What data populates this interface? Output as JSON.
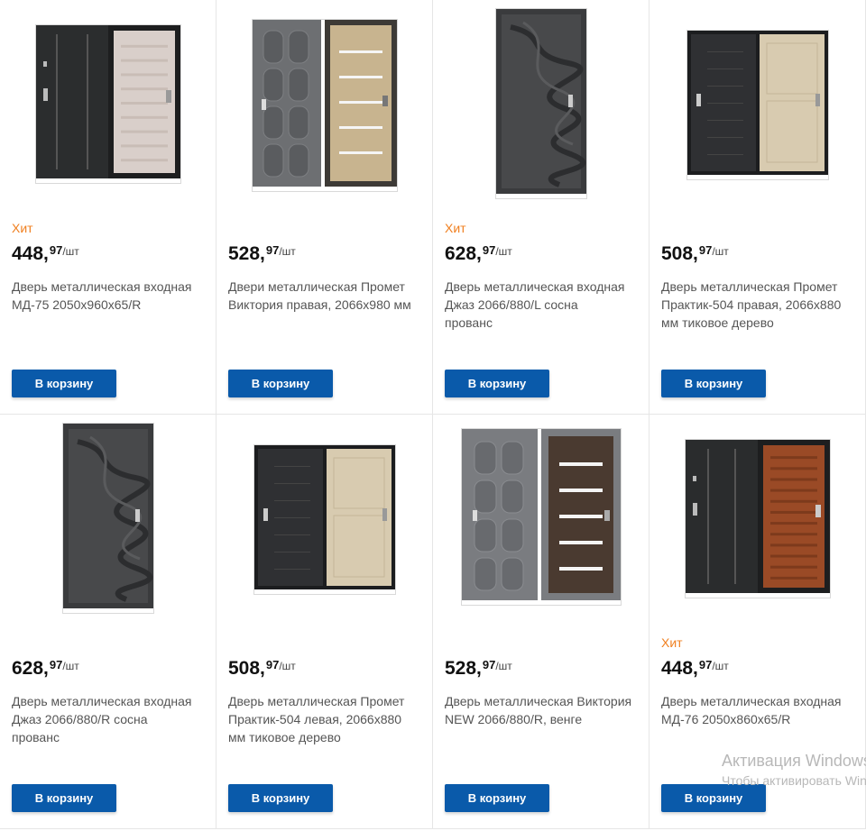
{
  "products": [
    {
      "badge": "Хит",
      "price_int": "448,",
      "price_dec": "97",
      "unit": "/шт",
      "title_lines": [
        "Дверь металлическая входная",
        "МД-75 2050х960х65/R"
      ],
      "button": "В корзину",
      "img": "md75"
    },
    {
      "badge": "",
      "price_int": "528,",
      "price_dec": "97",
      "unit": "/шт",
      "title_lines": [
        "Двери металлическая Промет",
        "Виктория правая, 2066х980 мм"
      ],
      "button": "В корзину",
      "img": "viktoria_light"
    },
    {
      "badge": "Хит",
      "price_int": "628,",
      "price_dec": "97",
      "unit": "/шт",
      "title_lines": [
        "Дверь металлическая входная",
        "Джаз 2066/880/L сосна",
        "прованс"
      ],
      "button": "В корзину",
      "img": "jazz_single"
    },
    {
      "badge": "",
      "price_int": "508,",
      "price_dec": "97",
      "unit": "/шт",
      "title_lines": [
        "Дверь металлическая Промет",
        "Практик-504 правая, 2066х880",
        "мм тиковое дерево"
      ],
      "button": "В корзину",
      "img": "praktik"
    },
    {
      "badge": "",
      "price_int": "628,",
      "price_dec": "97",
      "unit": "/шт",
      "title_lines": [
        "Дверь металлическая входная",
        "Джаз 2066/880/R сосна",
        "прованс"
      ],
      "button": "В корзину",
      "img": "jazz_single"
    },
    {
      "badge": "",
      "price_int": "508,",
      "price_dec": "97",
      "unit": "/шт",
      "title_lines": [
        "Дверь металлическая Промет",
        "Практик-504 левая, 2066х880",
        "мм тиковое дерево"
      ],
      "button": "В корзину",
      "img": "praktik"
    },
    {
      "badge": "",
      "price_int": "528,",
      "price_dec": "97",
      "unit": "/шт",
      "title_lines": [
        "Дверь металлическая Виктория",
        "NEW 2066/880/R, венге"
      ],
      "button": "В корзину",
      "img": "viktoria_dark"
    },
    {
      "badge": "Хит",
      "price_int": "448,",
      "price_dec": "97",
      "unit": "/шт",
      "title_lines": [
        "Дверь металлическая входная",
        "МД-76 2050х860х65/R"
      ],
      "button": "В корзину",
      "img": "md76"
    }
  ],
  "watermark": {
    "line1": "Активация Windows",
    "line2": "Чтобы активировать Windows"
  },
  "colors": {
    "badge": "#f07f1f",
    "button": "#0a5aaa"
  }
}
